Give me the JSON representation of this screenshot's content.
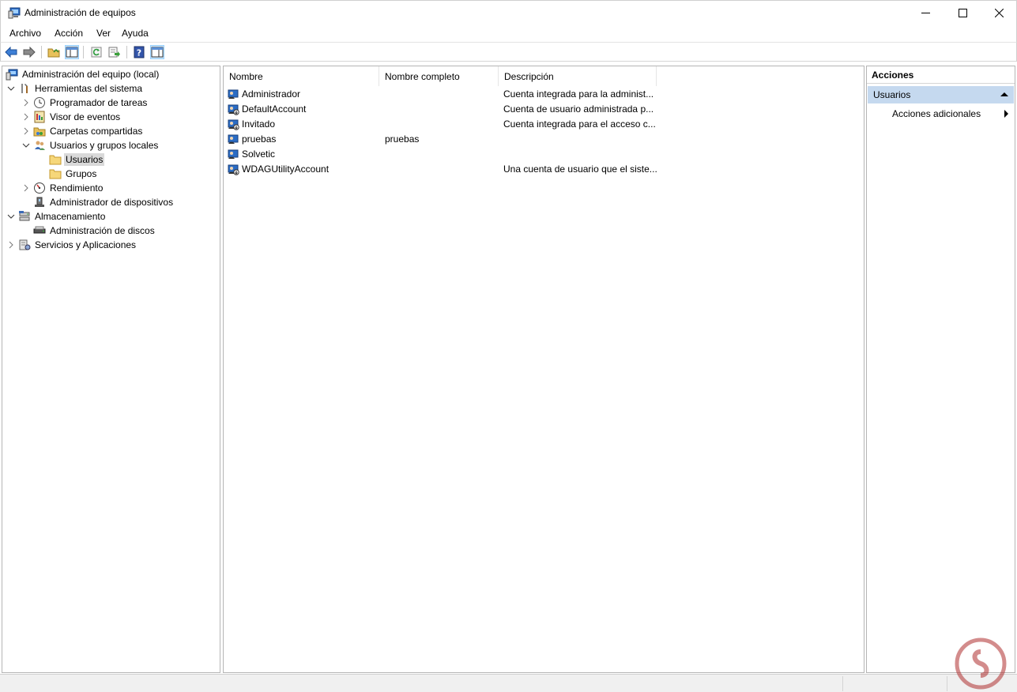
{
  "window": {
    "title": "Administración de equipos",
    "controls": [
      "minimize",
      "maximize",
      "close"
    ]
  },
  "menu": {
    "items": [
      "Archivo",
      "Acción",
      "Ver",
      "Ayuda"
    ]
  },
  "toolbar": {
    "buttons": [
      "back-icon",
      "forward-icon",
      "up-folder-icon",
      "show-hide-console-tree-icon",
      "refresh-icon",
      "export-list-icon",
      "help-icon",
      "show-hide-action-pane-icon"
    ]
  },
  "tree": {
    "root": "Administración del equipo (local)",
    "items": [
      {
        "label": "Herramientas del sistema",
        "expanded": true
      },
      {
        "label": "Programador de tareas",
        "expanded": false
      },
      {
        "label": "Visor de eventos",
        "expanded": false
      },
      {
        "label": "Carpetas compartidas",
        "expanded": false
      },
      {
        "label": "Usuarios y grupos locales",
        "expanded": true
      },
      {
        "label": "Usuarios",
        "selected": true
      },
      {
        "label": "Grupos"
      },
      {
        "label": "Rendimiento",
        "expanded": false
      },
      {
        "label": "Administrador de dispositivos"
      },
      {
        "label": "Almacenamiento",
        "expanded": true
      },
      {
        "label": "Administración de discos"
      },
      {
        "label": "Servicios y Aplicaciones",
        "expanded": false
      }
    ]
  },
  "list": {
    "columns": [
      "Nombre",
      "Nombre completo",
      "Descripción"
    ],
    "rows": [
      {
        "name": "Administrador",
        "fullname": "",
        "description": "Cuenta integrada para la administ..."
      },
      {
        "name": "DefaultAccount",
        "fullname": "",
        "description": "Cuenta de usuario administrada p..."
      },
      {
        "name": "Invitado",
        "fullname": "",
        "description": "Cuenta integrada para el acceso c..."
      },
      {
        "name": "pruebas",
        "fullname": "pruebas",
        "description": ""
      },
      {
        "name": "Solvetic",
        "fullname": "",
        "description": ""
      },
      {
        "name": "WDAGUtilityAccount",
        "fullname": "",
        "description": "Una cuenta de usuario que el siste..."
      }
    ]
  },
  "actions": {
    "title": "Acciones",
    "section": "Usuarios",
    "item": "Acciones adicionales"
  },
  "colors": {
    "section_bg": "#c5d9ef",
    "selected_bg": "#d9d9d9",
    "pressed_btn_bg": "#cce8ff"
  }
}
